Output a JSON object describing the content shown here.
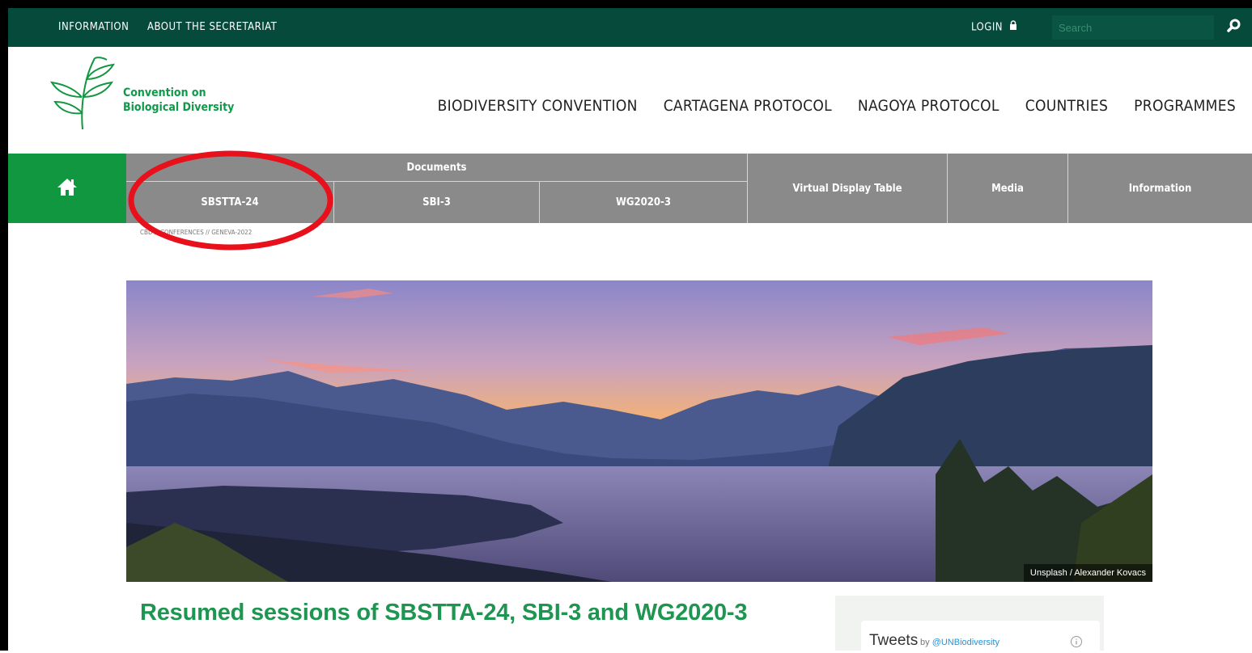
{
  "topbar": {
    "links": [
      "INFORMATION",
      "ABOUT THE SECRETARIAT"
    ],
    "login_label": "LOGIN",
    "search_placeholder": "Search"
  },
  "brand": {
    "line1": "Convention on",
    "line2": "Biological Diversity"
  },
  "main_nav": [
    "BIODIVERSITY CONVENTION",
    "CARTAGENA PROTOCOL",
    "NAGOYA PROTOCOL",
    "COUNTRIES",
    "PROGRAMMES"
  ],
  "sub_nav": {
    "documents_label": "Documents",
    "document_items": [
      "SBSTTA-24",
      "SBI-3",
      "WG2020-3"
    ],
    "items": [
      "Virtual Display Table",
      "Media",
      "Information"
    ]
  },
  "breadcrumb": "CBD // CONFERENCES // GENEVA-2022",
  "hero": {
    "credit": "Unsplash / Alexander Kovacs"
  },
  "headline": "Resumed sessions of SBSTTA-24, SBI-3 and WG2020-3",
  "tweets": {
    "title": "Tweets",
    "by": "by",
    "handle": "@UNBiodiversity"
  },
  "colors": {
    "topbar": "#064a3b",
    "brand_green": "#11973f",
    "subnav_gray": "#8a8a8a",
    "highlight_red": "#e8101a"
  },
  "icons": [
    "lock-icon",
    "search-icon",
    "home-icon",
    "info-icon"
  ]
}
